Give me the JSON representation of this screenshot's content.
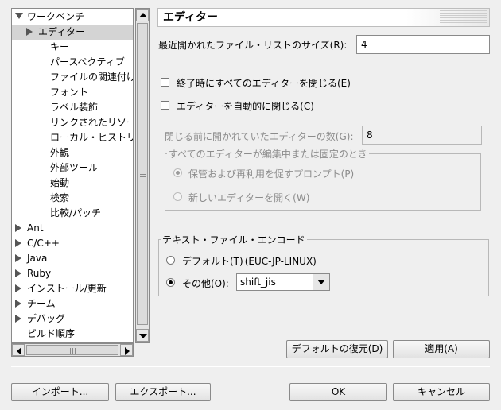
{
  "tree": {
    "items": [
      {
        "label": "ワークベンチ",
        "level": 0,
        "twisty": "expanded"
      },
      {
        "label": "エディター",
        "level": 1,
        "twisty": "collapsed",
        "selected": true
      },
      {
        "label": "キー",
        "level": 2
      },
      {
        "label": "パースペクティブ",
        "level": 2
      },
      {
        "label": "ファイルの関連付け",
        "level": 2
      },
      {
        "label": "フォント",
        "level": 2
      },
      {
        "label": "ラベル装飾",
        "level": 2
      },
      {
        "label": "リンクされたリソース",
        "level": 2
      },
      {
        "label": "ローカル・ヒストリー",
        "level": 2
      },
      {
        "label": "外観",
        "level": 2
      },
      {
        "label": "外部ツール",
        "level": 2
      },
      {
        "label": "始動",
        "level": 2
      },
      {
        "label": "検索",
        "level": 2
      },
      {
        "label": "比較/パッチ",
        "level": 2
      },
      {
        "label": "Ant",
        "level": 0,
        "twisty": "collapsed"
      },
      {
        "label": "C/C++",
        "level": 0,
        "twisty": "collapsed"
      },
      {
        "label": "Java",
        "level": 0,
        "twisty": "collapsed"
      },
      {
        "label": "Ruby",
        "level": 0,
        "twisty": "collapsed"
      },
      {
        "label": "インストール/更新",
        "level": 0,
        "twisty": "collapsed"
      },
      {
        "label": "チーム",
        "level": 0,
        "twisty": "collapsed"
      },
      {
        "label": "デバッグ",
        "level": 0,
        "twisty": "collapsed"
      },
      {
        "label": "ビルド順序",
        "level": 0
      }
    ]
  },
  "page": {
    "title": "エディター",
    "recent_files_label": "最近開かれたファイル・リストのサイズ(R):",
    "recent_files_value": "4",
    "close_on_exit_label": "終了時にすべてのエディターを閉じる(E)",
    "auto_close_label": "エディターを自動的に閉じる(C)",
    "editors_before_close_label": "閉じる前に開かれていたエディターの数(G):",
    "editors_before_close_value": "8",
    "dirty_group_title": "すべてのエディターが編集中または固定のとき",
    "dirty_prompt_label": "保管および再利用を促すプロンプト(P)",
    "dirty_new_editor_label": "新しいエディターを開く(W)",
    "encoding_group_title": "テキスト・ファイル・エンコード",
    "encoding_default_label": "デフォルト(T)",
    "encoding_default_value": "(EUC-JP-LINUX)",
    "encoding_other_label": "その他(O):",
    "encoding_other_value": "shift_jis",
    "restore_defaults_label": "デフォルトの復元(D)",
    "apply_label": "適用(A)"
  },
  "dialog": {
    "import_label": "インポート...",
    "export_label": "エクスポート...",
    "ok_label": "OK",
    "cancel_label": "キャンセル"
  }
}
